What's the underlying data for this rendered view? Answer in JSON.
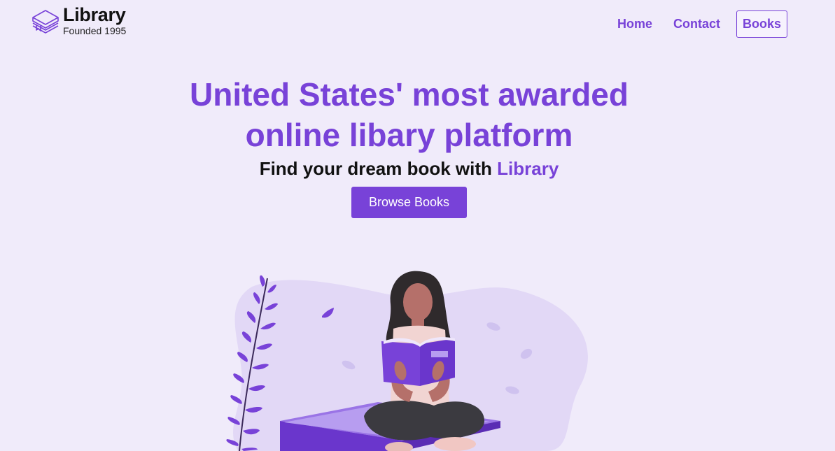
{
  "header": {
    "logo_title": "Library",
    "logo_subtitle": "Founded 1995",
    "nav": [
      {
        "label": "Home"
      },
      {
        "label": "Contact"
      },
      {
        "label": "Books"
      }
    ]
  },
  "hero": {
    "title_line1": "United States' most awarded",
    "title_line2": "online libary platform",
    "subtitle_prefix": "Find your dream book with ",
    "subtitle_accent": "Library",
    "browse_button": "Browse Books"
  },
  "colors": {
    "accent": "#7842d8",
    "background": "#f0ebfa",
    "text": "#111111"
  },
  "icons": {
    "logo": "stacked-books-icon",
    "illustration": "woman-reading-book-illustration"
  }
}
